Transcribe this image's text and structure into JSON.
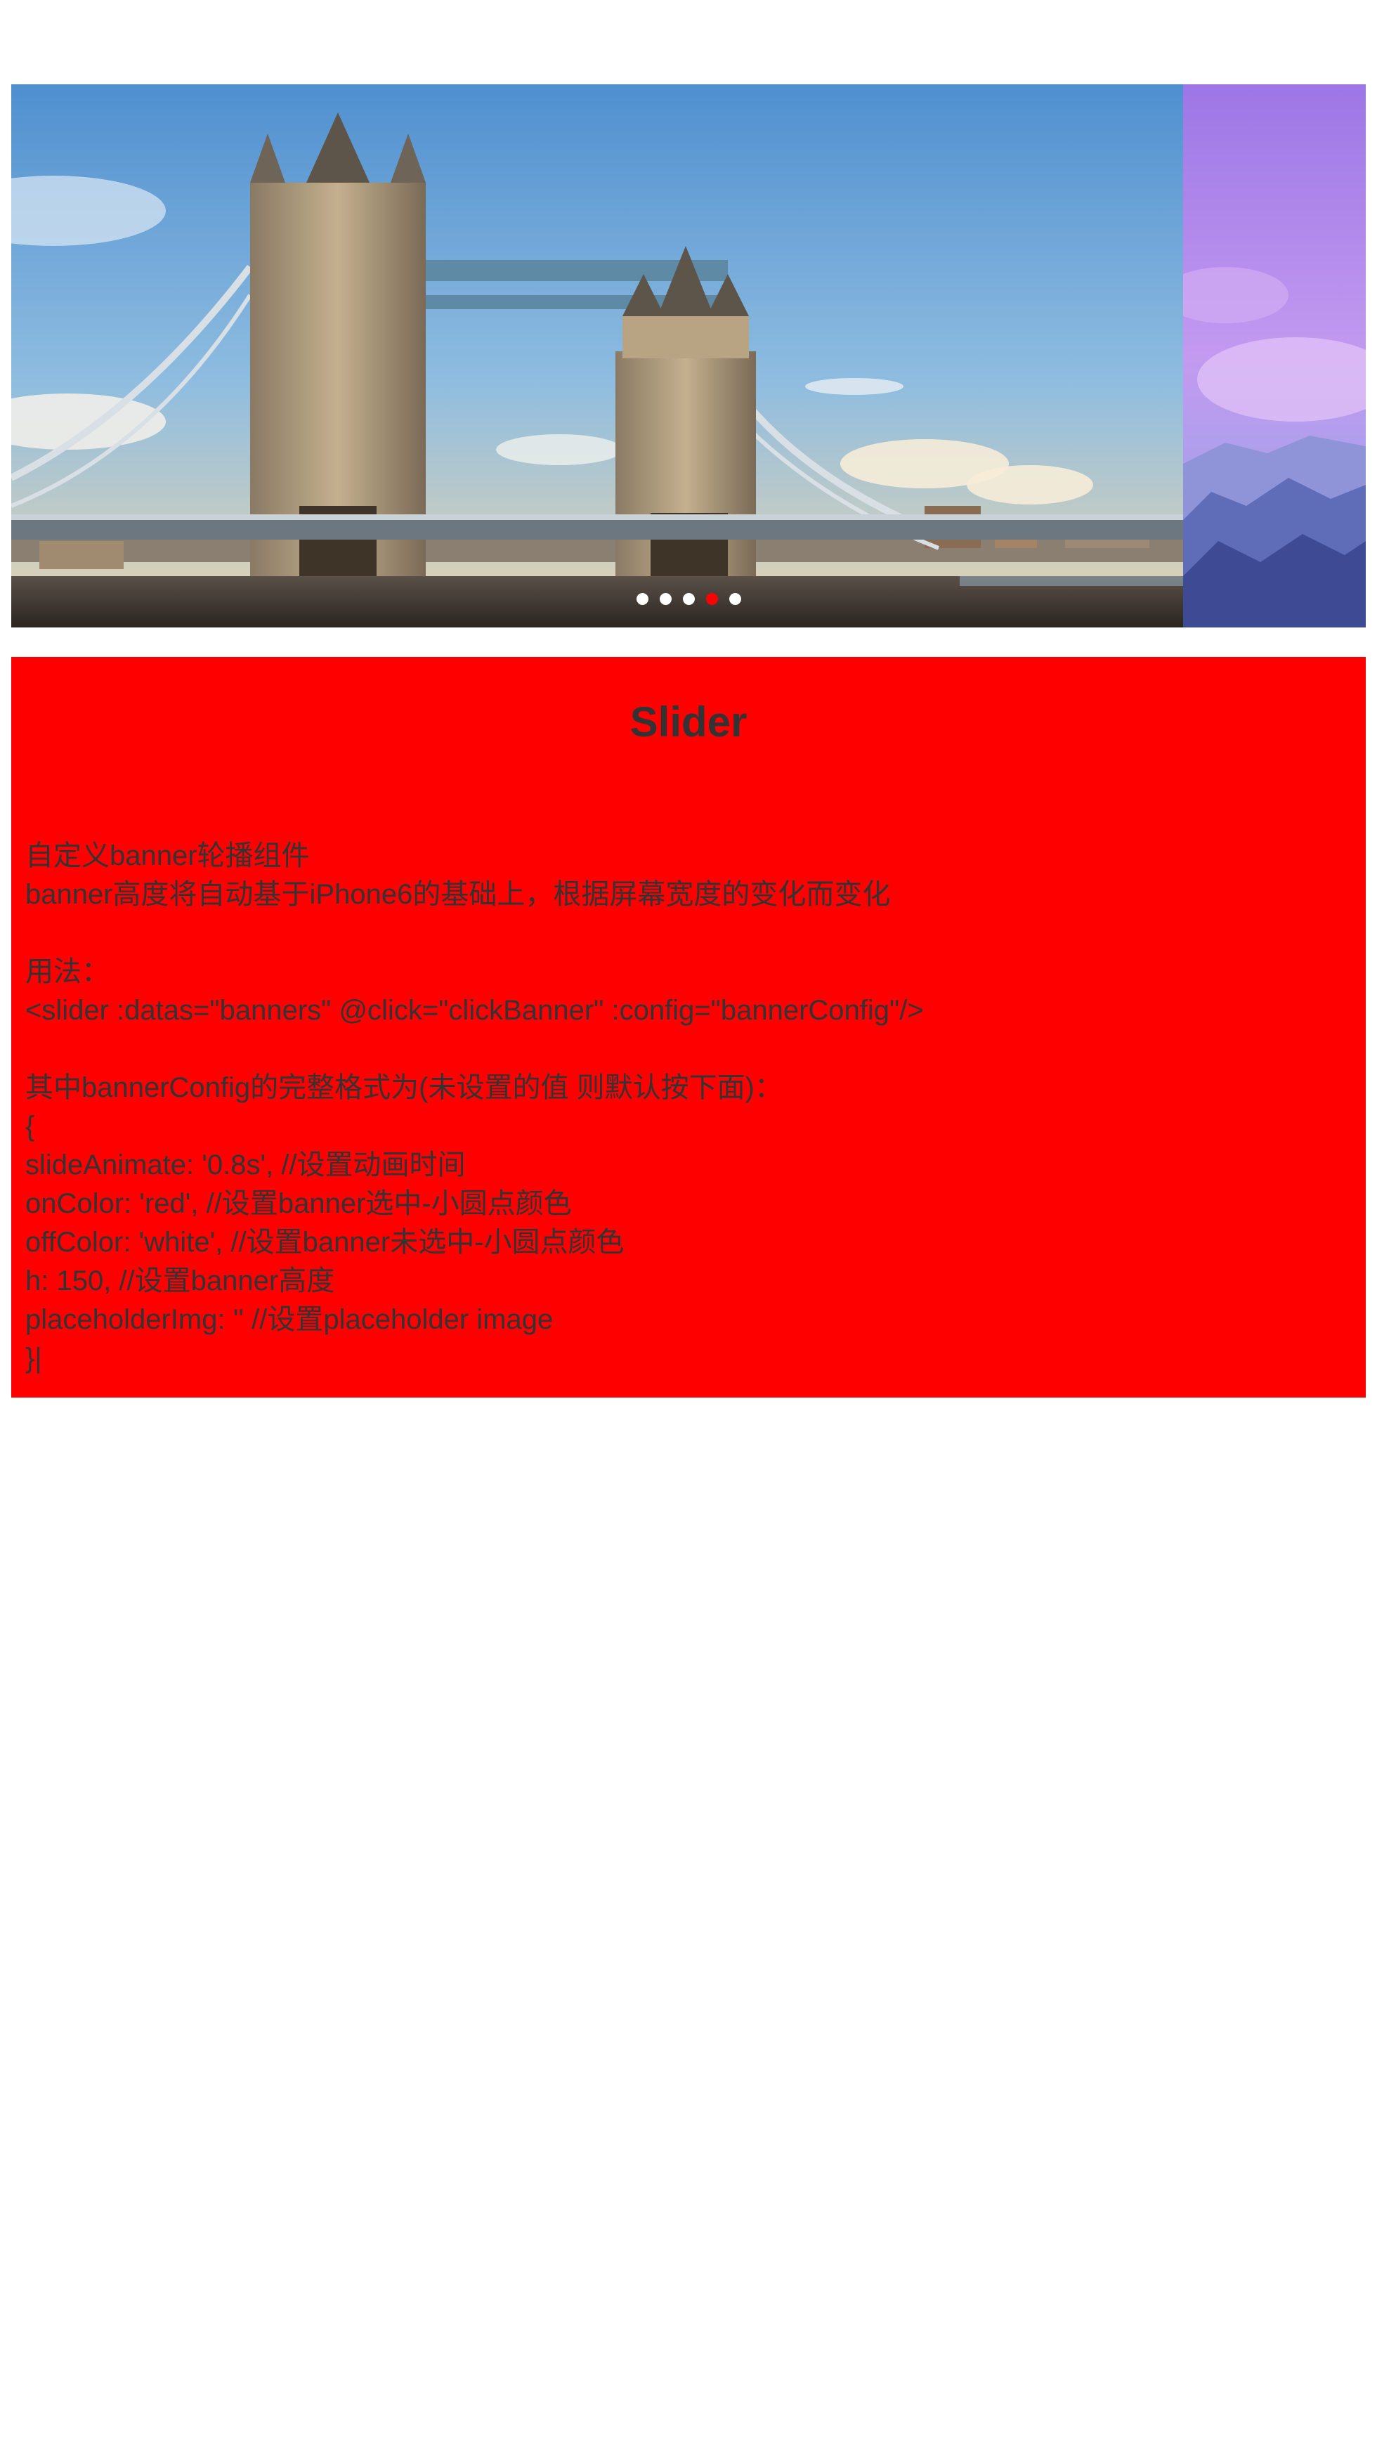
{
  "slider": {
    "slides": [
      {
        "name": "tower-bridge"
      },
      {
        "name": "purple-mountains"
      }
    ],
    "active_index": 3,
    "dot_count": 5,
    "on_color": "#ff0000",
    "off_color": "#ffffff"
  },
  "panel": {
    "background": "#ff0000",
    "title": "Slider",
    "lines": [
      "自定义banner轮播组件",
      "banner高度将自动基于iPhone6的基础上，根据屏幕宽度的变化而变化",
      "",
      "用法：",
      "<slider :datas=\"banners\" @click=\"clickBanner\" :config=\"bannerConfig\"/>",
      "",
      "其中bannerConfig的完整格式为(未设置的值 则默认按下面)：",
      "{",
      "slideAnimate: '0.8s', //设置动画时间",
      "onColor: 'red', //设置banner选中-小圆点颜色",
      "offColor: 'white', //设置banner未选中-小圆点颜色",
      "h: 150, //设置banner高度",
      "placeholderImg: '' //设置placeholder image",
      "}|"
    ]
  }
}
